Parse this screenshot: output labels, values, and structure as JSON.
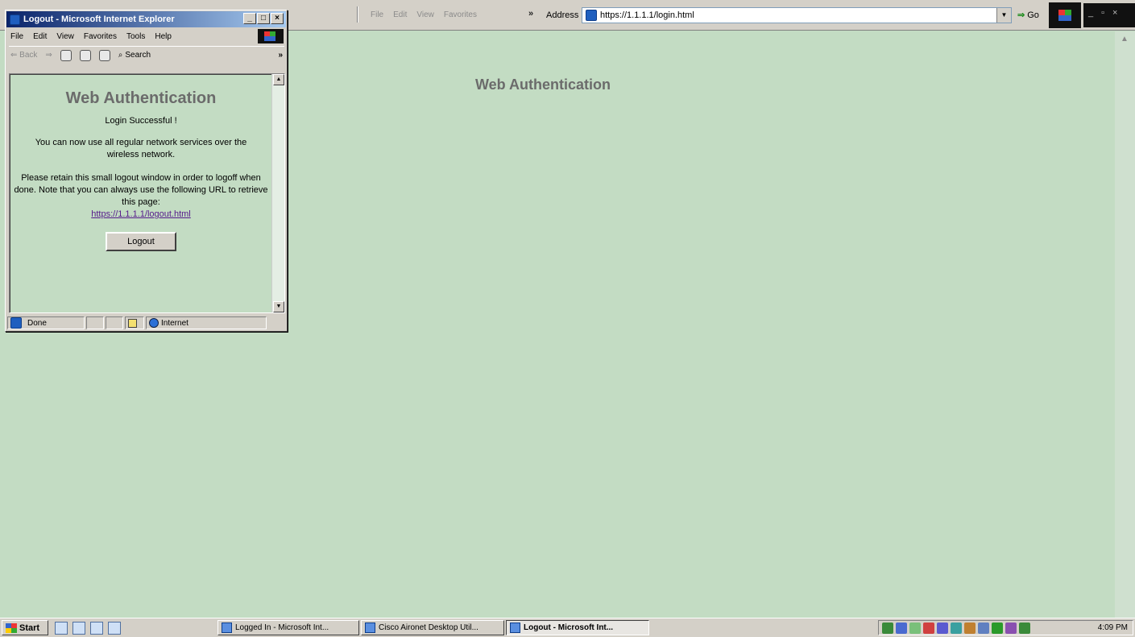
{
  "main_window": {
    "menu": [
      "File",
      "Edit",
      "View",
      "Favorites"
    ],
    "more_chevron": "»",
    "address_label": "Address",
    "address_value": "https://1.1.1.1/login.html",
    "go_label": "Go",
    "win_controls": [
      "_",
      "▫",
      "×"
    ],
    "heading": "Web Authentication"
  },
  "popup": {
    "title": "Logout - Microsoft Internet Explorer",
    "title_buttons": [
      "_",
      "□",
      "×"
    ],
    "menu": [
      "File",
      "Edit",
      "View",
      "Favorites",
      "Tools",
      "Help"
    ],
    "toolbar": {
      "back": "⇐ Back",
      "search": "Search",
      "more": "»"
    },
    "heading": "Web Authentication",
    "login_success": "Login Successful !",
    "services_msg": "You can now use all regular network services over the wireless network.",
    "retain_msg": "Please retain this small logout window in order to logoff when done. Note that you can always use the following URL to retrieve this page:",
    "logout_url": "https://1.1.1.1/logout.html",
    "logout_button": "Logout",
    "status_done": "Done",
    "status_zone": "Internet"
  },
  "taskbar": {
    "start": "Start",
    "tasks": [
      {
        "label": "Logged In - Microsoft Int..."
      },
      {
        "label": "Cisco Aironet Desktop Util..."
      },
      {
        "label": "Logout - Microsoft Int..."
      }
    ],
    "clock": "4:09 PM"
  },
  "colors": {
    "page_background": "#c3dcc3",
    "titlebar_start": "#0a246a",
    "titlebar_end": "#a6caf0",
    "heading_gray": "#6b6b6b",
    "link": "#551a8b"
  }
}
